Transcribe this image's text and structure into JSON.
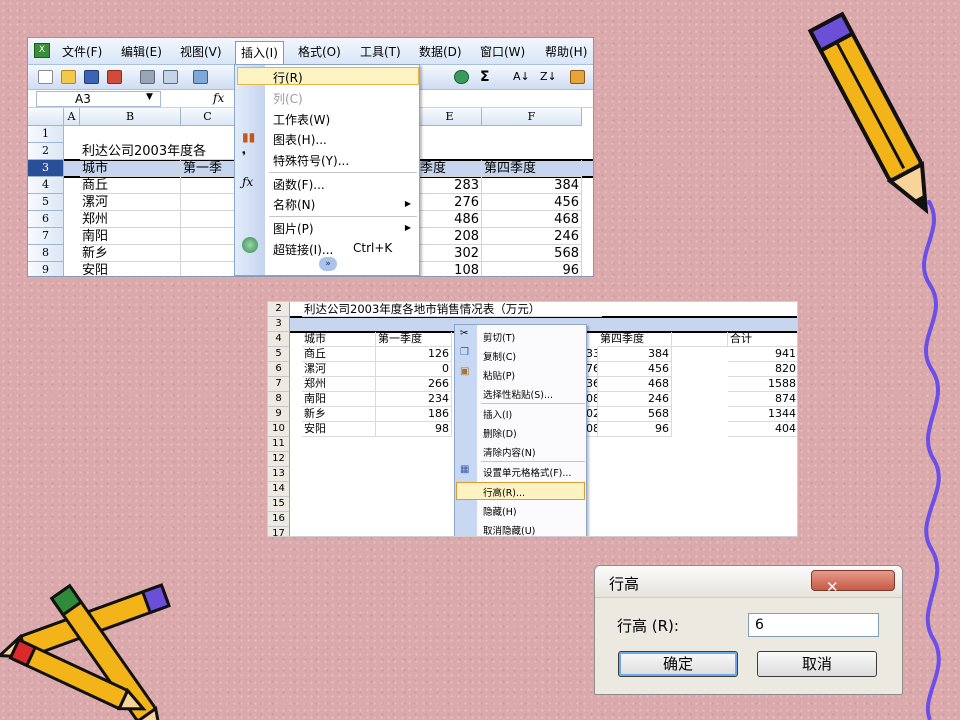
{
  "panel1": {
    "menubar": [
      {
        "label": "文件(F)"
      },
      {
        "label": "编辑(E)"
      },
      {
        "label": "视图(V)"
      },
      {
        "label": "插入(I)"
      },
      {
        "label": "格式(O)"
      },
      {
        "label": "工具(T)"
      },
      {
        "label": "数据(D)"
      },
      {
        "label": "窗口(W)"
      },
      {
        "label": "帮助(H)"
      }
    ],
    "active_menu": "插入(I)",
    "name_box": "A3",
    "fx_label": "fx",
    "toolbar_tail": [
      "Σ",
      "A↓",
      "Z↓"
    ],
    "columns": [
      "A",
      "B",
      "C",
      "E",
      "F"
    ],
    "rows": [
      "1",
      "2",
      "3",
      "4",
      "5",
      "6",
      "7",
      "8",
      "9"
    ],
    "cells": {
      "title": "利达公司2003年度各",
      "header_city": "城市",
      "header_q1": "第一季",
      "header_q3": "季度",
      "header_q4": "第四季度",
      "cities": [
        "商丘",
        "漯河",
        "郑州",
        "南阳",
        "新乡",
        "安阳"
      ],
      "col_e": [
        "283",
        "276",
        "486",
        "208",
        "302",
        "108"
      ],
      "col_f": [
        "384",
        "456",
        "468",
        "246",
        "568",
        "96"
      ]
    },
    "insert_menu": [
      {
        "label": "行(R)",
        "highlighted": true
      },
      {
        "label": "列(C)",
        "disabled": true
      },
      {
        "label": "工作表(W)"
      },
      {
        "label": "图表(H)...",
        "icon": "chart-icon"
      },
      {
        "label": "特殊符号(Y)...",
        "icon": "comma-icon"
      },
      {
        "label": "函数(F)...",
        "icon": "fx-icon"
      },
      {
        "label": "名称(N)",
        "submenu": true
      },
      {
        "label": "图片(P)",
        "submenu": true
      },
      {
        "label": "超链接(I)...",
        "shortcut": "Ctrl+K",
        "icon": "globe-link-icon"
      }
    ],
    "expand_glyph": "»"
  },
  "panel2": {
    "rows": [
      "2",
      "3",
      "4",
      "5",
      "6",
      "7",
      "8",
      "9",
      "10",
      "11",
      "12",
      "13",
      "14",
      "15",
      "16",
      "17"
    ],
    "title": "利达公司2003年度各地市销售情况表（万元）",
    "headers": {
      "city": "城市",
      "q1": "第一季度",
      "q4": "第四季度",
      "total": "合计"
    },
    "cities": [
      "商丘",
      "漯河",
      "郑州",
      "南阳",
      "新乡",
      "安阳"
    ],
    "q1": [
      "126",
      "0",
      "266",
      "234",
      "186",
      "98"
    ],
    "partial": [
      "33",
      "76",
      "36",
      "08",
      "02",
      "08"
    ],
    "q4": [
      "384",
      "456",
      "468",
      "246",
      "568",
      "96"
    ],
    "total": [
      "941",
      "820",
      "1588",
      "874",
      "1344",
      "404"
    ],
    "context_menu": [
      {
        "label": "剪切(T)",
        "icon": "scissors-icon"
      },
      {
        "label": "复制(C)",
        "icon": "copy-icon"
      },
      {
        "label": "粘贴(P)",
        "icon": "paste-icon"
      },
      {
        "label": "选择性粘贴(S)..."
      },
      {
        "label": "插入(I)"
      },
      {
        "label": "删除(D)"
      },
      {
        "label": "清除内容(N)"
      },
      {
        "label": "设置单元格格式(F)...",
        "icon": "format-cells-icon"
      },
      {
        "label": "行高(R)...",
        "highlighted": true
      },
      {
        "label": "隐藏(H)"
      },
      {
        "label": "取消隐藏(U)"
      }
    ]
  },
  "dialog": {
    "title": "行高",
    "close_glyph": "✕",
    "field_label": "行高 (R):",
    "field_value": "6",
    "ok_label": "确定",
    "cancel_label": "取消"
  },
  "colors": {
    "background": "#dba9ab",
    "selection_row": "#2a4f99",
    "menu_highlight": "#fdf3c2",
    "close_button": "#c45a46",
    "squiggle": "#6a4fe8"
  }
}
